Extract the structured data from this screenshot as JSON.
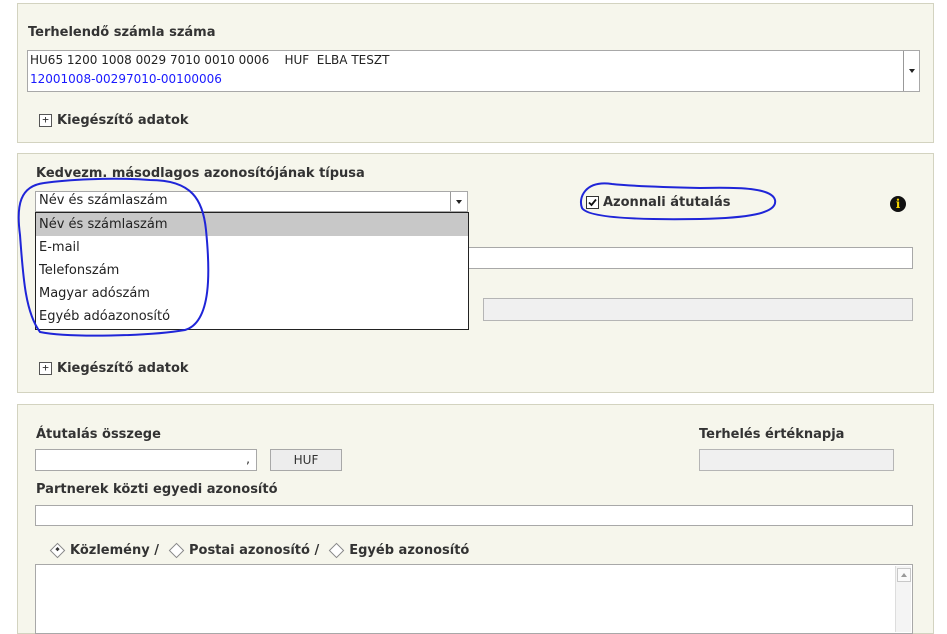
{
  "debit_account": {
    "label": "Terhelendő számla száma",
    "iban_line": "HU65 1200 1008 0029 7010 0010 0006    HUF  ELBA TESZT",
    "account_number": "12001008-00297010-00100006",
    "expander_symbol": "+",
    "extra_label": "Kiegészítő adatok"
  },
  "beneficiary": {
    "id_type_label": "Kedvezm. másodlagos azonosítójának típusa",
    "selected": "Név és számlaszám",
    "options": [
      "Név és számlaszám",
      "E-mail",
      "Telefonszám",
      "Magyar adószám",
      "Egyéb adóazonosító"
    ],
    "instant_label": "Azonnali átutalás",
    "instant_checked": true,
    "info_icon_text": "i",
    "expander_symbol": "+",
    "extra_label": "Kiegészítő adatok"
  },
  "transfer": {
    "amount_label": "Átutalás összege",
    "amount_decimal_sep": ",",
    "currency": "HUF",
    "value_date_label": "Terhelés értéknapja",
    "partner_id_label": "Partnerek közti egyedi azonosító",
    "radio_options": [
      "Közlemény /",
      "Postai azonosító /",
      "Egyéb azonosító"
    ],
    "radio_selected": 0
  },
  "colors": {
    "panel_bg": "#f6f6ec",
    "account_blue": "#1a1aff",
    "annotation_blue": "#1f25d8",
    "highlight": "#c8c8c8"
  }
}
